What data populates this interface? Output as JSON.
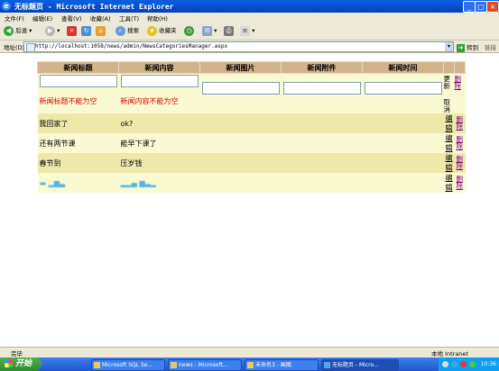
{
  "window": {
    "title": "无标题页 - Microsoft Internet Explorer",
    "icon": "ie-icon",
    "buttons": {
      "minimize": "_",
      "maximize": "□",
      "close": "×"
    }
  },
  "menu": [
    "文件(F)",
    "编辑(E)",
    "查看(V)",
    "收藏(A)",
    "工具(T)",
    "帮助(H)"
  ],
  "toolbar": {
    "back": "后退",
    "search": "搜索",
    "favorites": "收藏夹"
  },
  "address": {
    "label": "地址(D)",
    "url": "http://localhost:1058/news/admin/NewsCategoriesManager.aspx",
    "go": "转到",
    "links": "链接"
  },
  "grid": {
    "headers": [
      "新闻标题",
      "新闻内容",
      "新闻图片",
      "新闻附件",
      "新闻时间"
    ],
    "edit_row": {
      "title_value": "",
      "content_value": "",
      "title_error": "新闻标题不能为空",
      "content_error": "新闻内容不能为空",
      "update": "更新",
      "cancel": "取消",
      "delete": "删除"
    },
    "rows": [
      {
        "title": "我回家了",
        "content": "ok?",
        "edit": "编辑",
        "delete": "删除"
      },
      {
        "title": "还有两节课",
        "content": "能早下课了",
        "edit": "编辑",
        "delete": "删除"
      },
      {
        "title": "春节到",
        "content": "压岁钱",
        "edit": "编辑",
        "delete": "删除"
      },
      {
        "title": "",
        "content": "",
        "edit": "编辑",
        "delete": "删除"
      }
    ]
  },
  "status": {
    "left": "完毕",
    "right": "本地 Intranet"
  },
  "taskbar": {
    "start": "开始",
    "tasks": [
      "Microsoft SQL Se...",
      "news - Microsoft...",
      "未命名3 - 画图",
      "无标题页 - Micro..."
    ],
    "clock": "10:36"
  }
}
